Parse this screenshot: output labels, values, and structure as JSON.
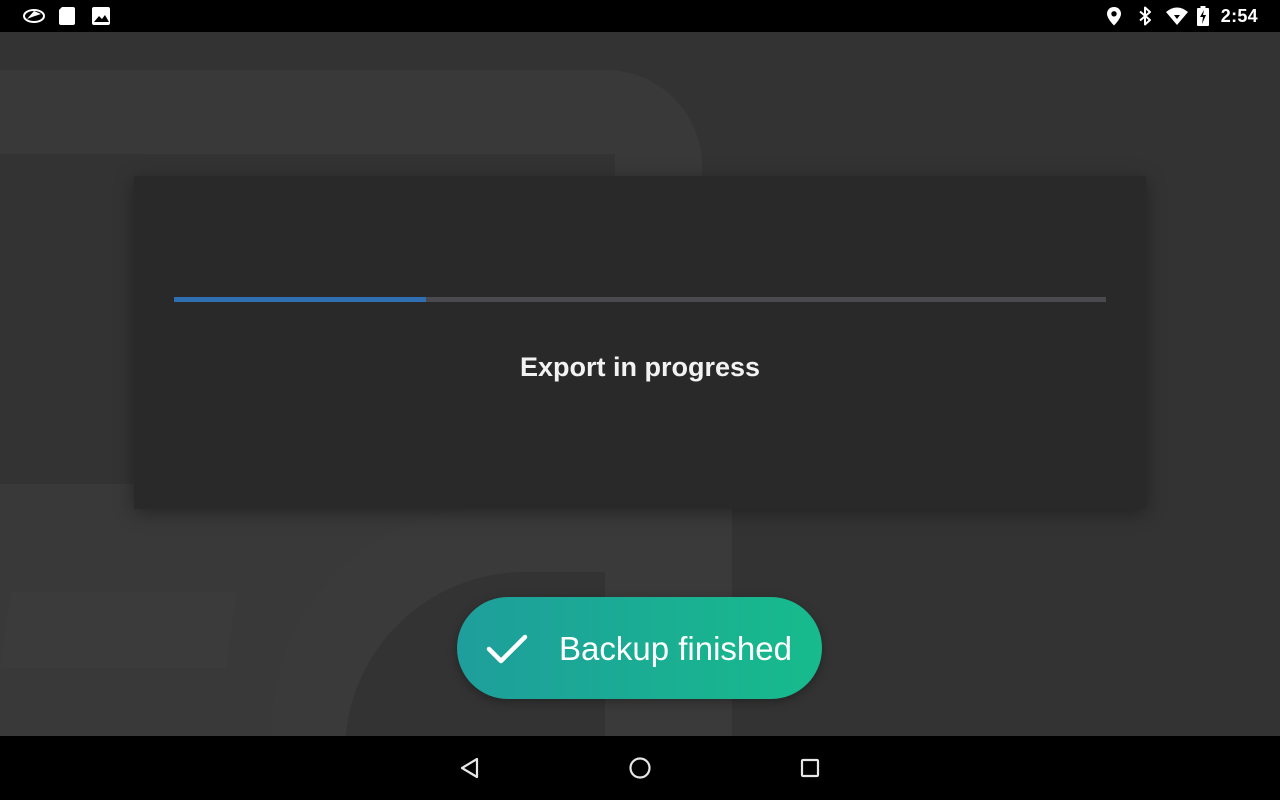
{
  "status_bar": {
    "time": "2:54",
    "left_icons": [
      "app-notification-icon",
      "sd-card-icon",
      "image-icon"
    ],
    "right_icons": [
      "location-icon",
      "bluetooth-icon",
      "wifi-icon",
      "battery-charging-icon"
    ]
  },
  "dialog": {
    "message": "Export in progress",
    "progress": 0.27,
    "progress_color": "#2f6eb0",
    "track_color": "#4a4a4e"
  },
  "toast": {
    "icon": "checkmark-icon",
    "text": "Backup finished",
    "gradient": [
      "#1e9e9c",
      "#17bb8c"
    ]
  },
  "nav_bar": {
    "buttons": [
      "back-icon",
      "home-icon",
      "recents-icon"
    ]
  }
}
